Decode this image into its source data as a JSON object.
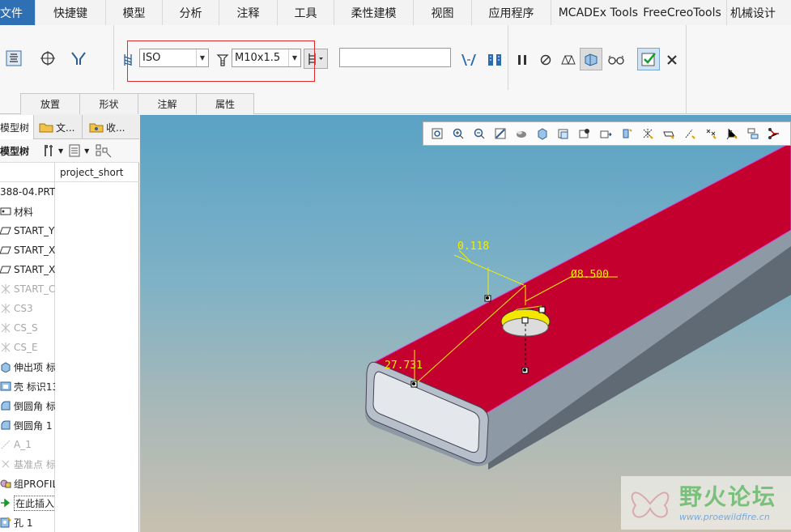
{
  "menu": {
    "items": [
      "文件",
      "快捷键",
      "模型",
      "分析",
      "注释",
      "工具",
      "柔性建模",
      "视图",
      "应用程序",
      "MCADEx Tools",
      "FreeCreoTools",
      "机械设计"
    ]
  },
  "ribbon": {
    "thread_standard": "ISO",
    "screw_size": "M10x1.5",
    "depth_value": "",
    "groups": [
      "放置",
      "形状",
      "注解",
      "属性"
    ],
    "highlight_color": "#e0282d"
  },
  "panel": {
    "tabs": [
      "模型树",
      "文...",
      "收..."
    ],
    "toolbar_label": "模型树",
    "column_header": "project_short",
    "tree": [
      {
        "label": "388-04.PRT",
        "icon": "part-icon",
        "dim": false
      },
      {
        "label": "材料",
        "icon": "material-icon",
        "dim": false
      },
      {
        "label": "START_Y",
        "icon": "datum-plane-icon",
        "dim": false
      },
      {
        "label": "START_X",
        "icon": "datum-plane-icon",
        "dim": false
      },
      {
        "label": "START_X",
        "icon": "datum-plane-icon",
        "dim": false
      },
      {
        "label": "START_C",
        "icon": "coordinate-system-icon",
        "dim": true
      },
      {
        "label": "CS3",
        "icon": "coordinate-system-icon",
        "dim": true
      },
      {
        "label": "CS_S",
        "icon": "coordinate-system-icon",
        "dim": true
      },
      {
        "label": "CS_E",
        "icon": "coordinate-system-icon",
        "dim": true
      },
      {
        "label": "伸出项 标",
        "icon": "extrude-icon",
        "dim": false
      },
      {
        "label": "壳 标识13",
        "icon": "shell-icon",
        "dim": false
      },
      {
        "label": "倒圆角 标",
        "icon": "round-icon",
        "dim": false
      },
      {
        "label": "倒圆角 1",
        "icon": "round-icon",
        "dim": false
      },
      {
        "label": "A_1",
        "icon": "datum-axis-icon",
        "dim": true
      },
      {
        "label": "基准点 标",
        "icon": "datum-point-icon",
        "dim": true
      },
      {
        "label": "组PROFIL",
        "icon": "group-icon",
        "dim": false
      },
      {
        "label": "在此插入",
        "icon": "insert-here-icon",
        "dim": false
      },
      {
        "label": "孔 1",
        "icon": "hole-icon",
        "dim": false
      }
    ]
  },
  "viewport": {
    "dims": {
      "d1": "0.118",
      "d2": "Ø8.500",
      "d3": "27.731"
    },
    "colors": {
      "top_face": "#c4002f",
      "body": "#8c97a3",
      "dimension": "#f0f000"
    }
  },
  "watermark": {
    "title": "野火论坛",
    "url": "www.proewildfire.cn"
  }
}
